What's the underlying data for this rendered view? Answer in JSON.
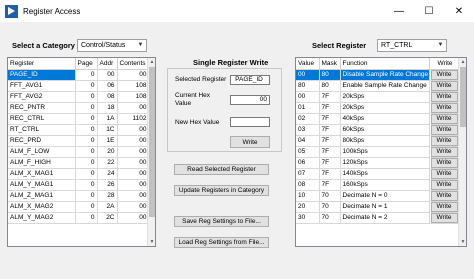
{
  "window": {
    "title": "Register Access",
    "minimize": "—",
    "maximize": "☐",
    "close": "✕"
  },
  "left": {
    "category_label": "Select a Category",
    "category_value": "Control/Status",
    "columns": [
      "Register",
      "Page",
      "Addr",
      "Contents"
    ],
    "rows": [
      {
        "register": "PAGE_ID",
        "page": "0",
        "addr": "00",
        "contents": "00"
      },
      {
        "register": "FFT_AVG1",
        "page": "0",
        "addr": "06",
        "contents": "108"
      },
      {
        "register": "FFT_AVG2",
        "page": "0",
        "addr": "08",
        "contents": "108"
      },
      {
        "register": "REC_PNTR",
        "page": "0",
        "addr": "18",
        "contents": "00"
      },
      {
        "register": "REC_CTRL",
        "page": "0",
        "addr": "1A",
        "contents": "1102"
      },
      {
        "register": "RT_CTRL",
        "page": "0",
        "addr": "1C",
        "contents": "00"
      },
      {
        "register": "REC_PRD",
        "page": "0",
        "addr": "1E",
        "contents": "00"
      },
      {
        "register": "ALM_F_LOW",
        "page": "0",
        "addr": "20",
        "contents": "00"
      },
      {
        "register": "ALM_F_HIGH",
        "page": "0",
        "addr": "22",
        "contents": "00"
      },
      {
        "register": "ALM_X_MAG1",
        "page": "0",
        "addr": "24",
        "contents": "00"
      },
      {
        "register": "ALM_Y_MAG1",
        "page": "0",
        "addr": "26",
        "contents": "00"
      },
      {
        "register": "ALM_Z_MAG1",
        "page": "0",
        "addr": "28",
        "contents": "00"
      },
      {
        "register": "ALM_X_MAG2",
        "page": "0",
        "addr": "2A",
        "contents": "00"
      },
      {
        "register": "ALM_Y_MAG2",
        "page": "0",
        "addr": "2C",
        "contents": "00"
      }
    ]
  },
  "middle": {
    "title": "Single Register Write",
    "selected_register_label": "Selected Register",
    "selected_register_value": "PAGE_ID",
    "current_hex_label": "Current Hex Value",
    "current_hex_value": "00",
    "new_hex_label": "New Hex Value",
    "new_hex_value": "",
    "write_label": "Write",
    "read_selected": "Read Selected Register",
    "update_in_category": "Update Registers in Category",
    "save_settings": "Save Reg Settings to File...",
    "load_settings": "Load Reg Settings from File..."
  },
  "right": {
    "register_label": "Select Register",
    "register_value": "RT_CTRL",
    "columns": [
      "Value",
      "Mask",
      "Function",
      "Write"
    ],
    "write_label": "Write",
    "rows": [
      {
        "value": "00",
        "mask": "80",
        "function": "Disable Sample Rate Change"
      },
      {
        "value": "80",
        "mask": "80",
        "function": "Enable Sample Rate Change"
      },
      {
        "value": "00",
        "mask": "7F",
        "function": "20kSps"
      },
      {
        "value": "01",
        "mask": "7F",
        "function": "20kSps"
      },
      {
        "value": "02",
        "mask": "7F",
        "function": "40kSps"
      },
      {
        "value": "03",
        "mask": "7F",
        "function": "60kSps"
      },
      {
        "value": "04",
        "mask": "7F",
        "function": "80kSps"
      },
      {
        "value": "05",
        "mask": "7F",
        "function": "100kSps"
      },
      {
        "value": "06",
        "mask": "7F",
        "function": "120kSps"
      },
      {
        "value": "07",
        "mask": "7F",
        "function": "140kSps"
      },
      {
        "value": "08",
        "mask": "7F",
        "function": "160kSps"
      },
      {
        "value": "10",
        "mask": "70",
        "function": "Decimate N = 0"
      },
      {
        "value": "20",
        "mask": "70",
        "function": "Decimate N = 1"
      },
      {
        "value": "30",
        "mask": "70",
        "function": "Decimate N = 2"
      }
    ]
  }
}
